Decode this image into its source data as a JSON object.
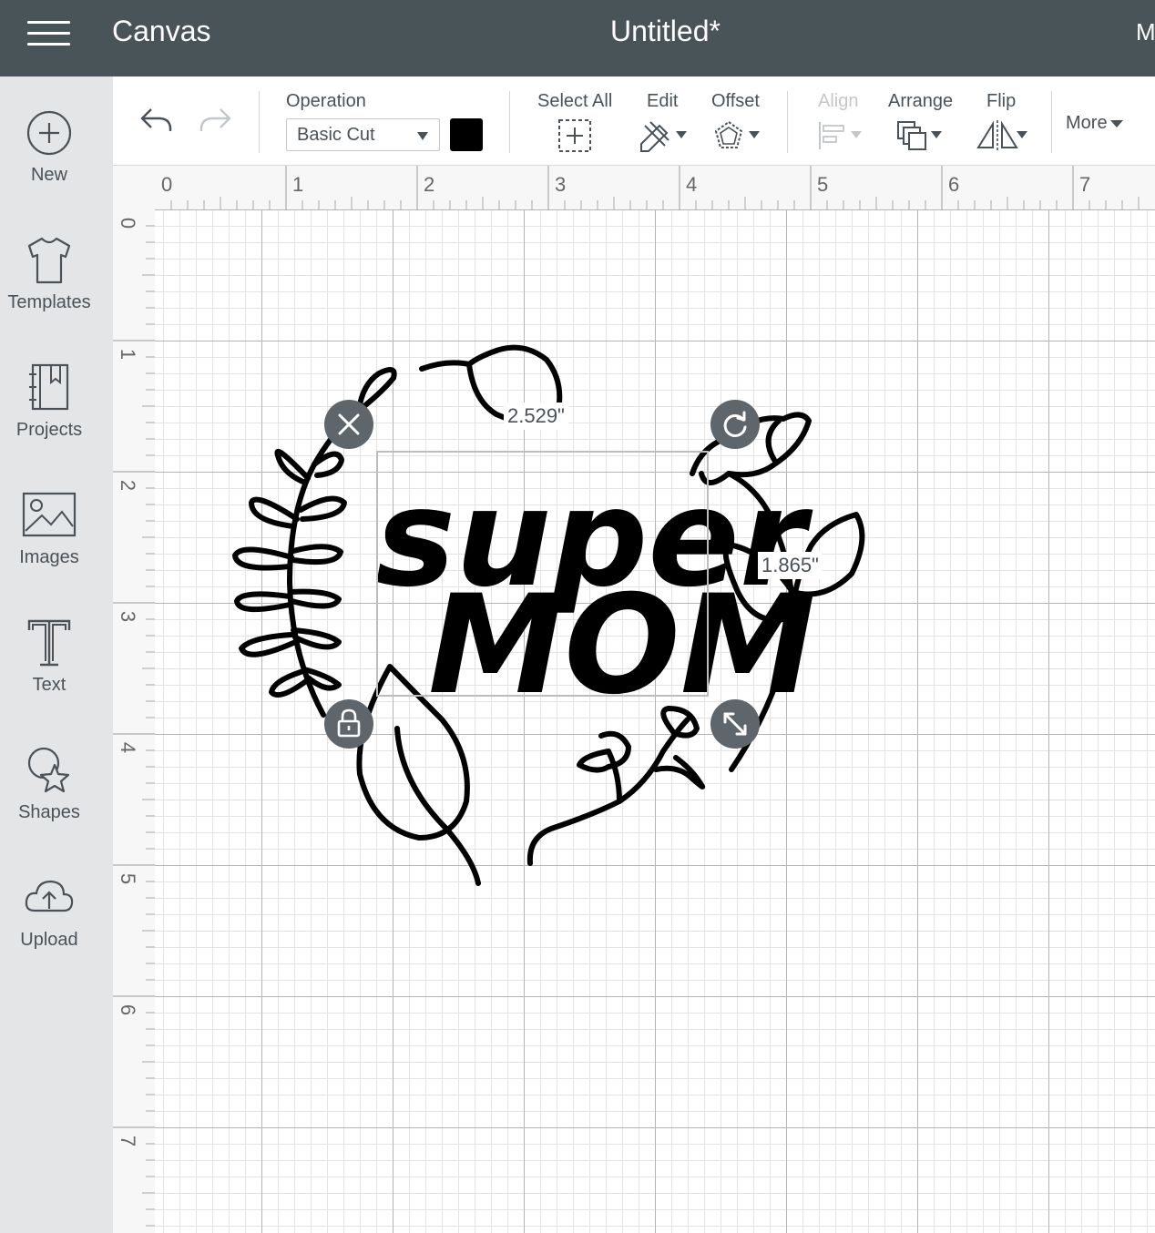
{
  "header": {
    "menu_icon": "hamburger-menu-icon",
    "app_title": "Canvas",
    "document_title": "Untitled*",
    "edge_text": "M"
  },
  "sidebar": {
    "items": [
      {
        "label": "New",
        "icon": "plus-circle-icon"
      },
      {
        "label": "Templates",
        "icon": "tshirt-icon"
      },
      {
        "label": "Projects",
        "icon": "notebook-icon"
      },
      {
        "label": "Images",
        "icon": "image-icon"
      },
      {
        "label": "Text",
        "icon": "text-t-icon"
      },
      {
        "label": "Shapes",
        "icon": "shapes-icon"
      },
      {
        "label": "Upload",
        "icon": "cloud-upload-icon"
      }
    ]
  },
  "toolbar": {
    "undo_icon": "undo-icon",
    "redo_icon": "redo-icon",
    "operation_label": "Operation",
    "operation_value": "Basic Cut",
    "color_swatch": "#000000",
    "select_all_label": "Select All",
    "edit_label": "Edit",
    "offset_label": "Offset",
    "align_label": "Align",
    "arrange_label": "Arrange",
    "flip_label": "Flip",
    "more_label": "More"
  },
  "canvas": {
    "ruler_top": [
      "0",
      "1",
      "2",
      "3",
      "4",
      "5",
      "6",
      "7"
    ],
    "ruler_left": [
      "0",
      "1",
      "2",
      "3",
      "4",
      "5",
      "6",
      "7"
    ],
    "selection": {
      "width_label": "2.529\"",
      "height_label": "1.865\""
    },
    "design_text": {
      "line1": "super",
      "line2": "MOM"
    }
  },
  "colors": {
    "topbar": "#495459",
    "sidebar": "#e4e5e7",
    "handle": "#5e666b",
    "text": "#4a5257"
  }
}
